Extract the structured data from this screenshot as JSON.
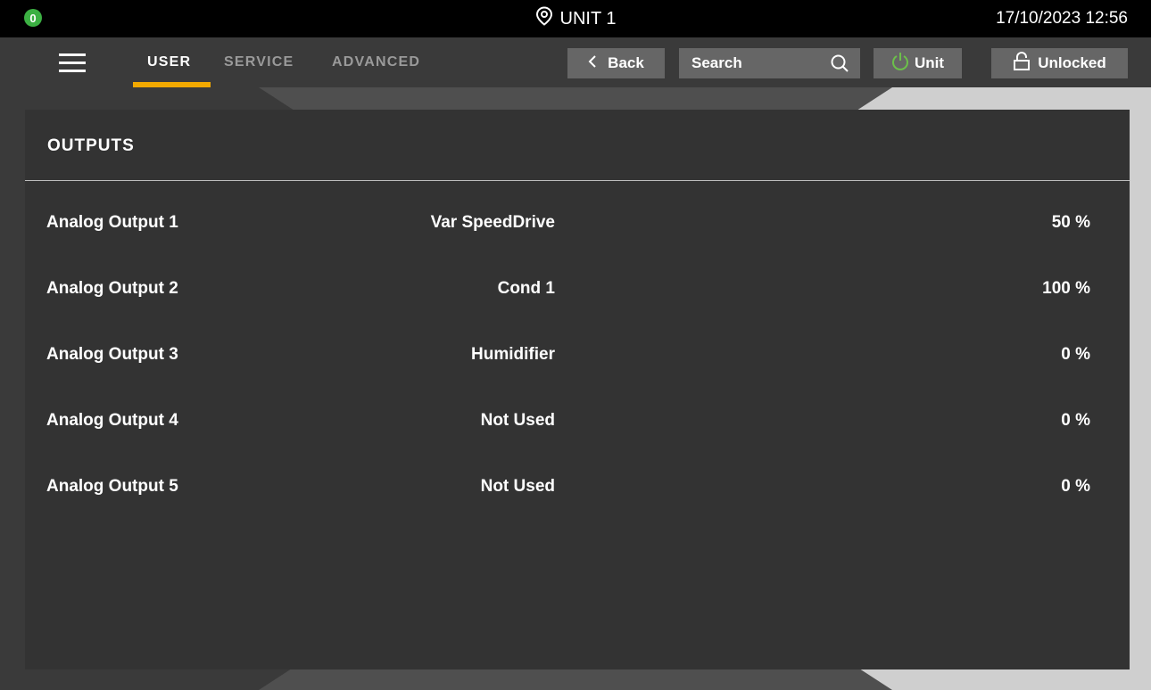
{
  "status_bar": {
    "alarm_count": "0",
    "unit_name": "UNIT 1",
    "datetime": "17/10/2023 12:56",
    "alarm_color": "#3cb043"
  },
  "nav": {
    "tabs": [
      {
        "label": "USER",
        "active": true
      },
      {
        "label": "SERVICE",
        "active": false
      },
      {
        "label": "ADVANCED",
        "active": false
      }
    ],
    "back_label": "Back",
    "search_label": "Search",
    "unit_label": "Unit",
    "lock_label": "Unlocked",
    "accent_color": "#f2a900",
    "power_icon_color": "#6cc04a"
  },
  "panel": {
    "title": "OUTPUTS",
    "rows": [
      {
        "name": "Analog Output 1",
        "desc": "Var SpeedDrive",
        "value": "50 %"
      },
      {
        "name": "Analog Output 2",
        "desc": "Cond 1",
        "value": "100 %"
      },
      {
        "name": "Analog Output 3",
        "desc": "Humidifier",
        "value": "0 %"
      },
      {
        "name": "Analog Output 4",
        "desc": "Not Used",
        "value": "0 %"
      },
      {
        "name": "Analog Output 5",
        "desc": "Not Used",
        "value": "0 %"
      }
    ]
  }
}
